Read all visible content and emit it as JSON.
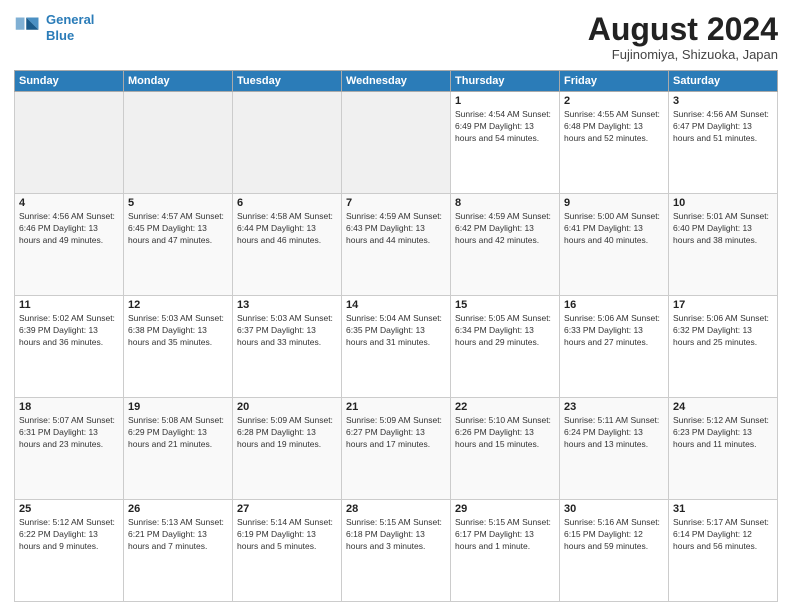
{
  "header": {
    "logo_line1": "General",
    "logo_line2": "Blue",
    "title": "August 2024",
    "subtitle": "Fujinomiya, Shizuoka, Japan"
  },
  "weekdays": [
    "Sunday",
    "Monday",
    "Tuesday",
    "Wednesday",
    "Thursday",
    "Friday",
    "Saturday"
  ],
  "weeks": [
    [
      {
        "day": "",
        "empty": true
      },
      {
        "day": "",
        "empty": true
      },
      {
        "day": "",
        "empty": true
      },
      {
        "day": "",
        "empty": true
      },
      {
        "day": "1",
        "info": "Sunrise: 4:54 AM\nSunset: 6:49 PM\nDaylight: 13 hours\nand 54 minutes."
      },
      {
        "day": "2",
        "info": "Sunrise: 4:55 AM\nSunset: 6:48 PM\nDaylight: 13 hours\nand 52 minutes."
      },
      {
        "day": "3",
        "info": "Sunrise: 4:56 AM\nSunset: 6:47 PM\nDaylight: 13 hours\nand 51 minutes."
      }
    ],
    [
      {
        "day": "4",
        "info": "Sunrise: 4:56 AM\nSunset: 6:46 PM\nDaylight: 13 hours\nand 49 minutes."
      },
      {
        "day": "5",
        "info": "Sunrise: 4:57 AM\nSunset: 6:45 PM\nDaylight: 13 hours\nand 47 minutes."
      },
      {
        "day": "6",
        "info": "Sunrise: 4:58 AM\nSunset: 6:44 PM\nDaylight: 13 hours\nand 46 minutes."
      },
      {
        "day": "7",
        "info": "Sunrise: 4:59 AM\nSunset: 6:43 PM\nDaylight: 13 hours\nand 44 minutes."
      },
      {
        "day": "8",
        "info": "Sunrise: 4:59 AM\nSunset: 6:42 PM\nDaylight: 13 hours\nand 42 minutes."
      },
      {
        "day": "9",
        "info": "Sunrise: 5:00 AM\nSunset: 6:41 PM\nDaylight: 13 hours\nand 40 minutes."
      },
      {
        "day": "10",
        "info": "Sunrise: 5:01 AM\nSunset: 6:40 PM\nDaylight: 13 hours\nand 38 minutes."
      }
    ],
    [
      {
        "day": "11",
        "info": "Sunrise: 5:02 AM\nSunset: 6:39 PM\nDaylight: 13 hours\nand 36 minutes."
      },
      {
        "day": "12",
        "info": "Sunrise: 5:03 AM\nSunset: 6:38 PM\nDaylight: 13 hours\nand 35 minutes."
      },
      {
        "day": "13",
        "info": "Sunrise: 5:03 AM\nSunset: 6:37 PM\nDaylight: 13 hours\nand 33 minutes."
      },
      {
        "day": "14",
        "info": "Sunrise: 5:04 AM\nSunset: 6:35 PM\nDaylight: 13 hours\nand 31 minutes."
      },
      {
        "day": "15",
        "info": "Sunrise: 5:05 AM\nSunset: 6:34 PM\nDaylight: 13 hours\nand 29 minutes."
      },
      {
        "day": "16",
        "info": "Sunrise: 5:06 AM\nSunset: 6:33 PM\nDaylight: 13 hours\nand 27 minutes."
      },
      {
        "day": "17",
        "info": "Sunrise: 5:06 AM\nSunset: 6:32 PM\nDaylight: 13 hours\nand 25 minutes."
      }
    ],
    [
      {
        "day": "18",
        "info": "Sunrise: 5:07 AM\nSunset: 6:31 PM\nDaylight: 13 hours\nand 23 minutes."
      },
      {
        "day": "19",
        "info": "Sunrise: 5:08 AM\nSunset: 6:29 PM\nDaylight: 13 hours\nand 21 minutes."
      },
      {
        "day": "20",
        "info": "Sunrise: 5:09 AM\nSunset: 6:28 PM\nDaylight: 13 hours\nand 19 minutes."
      },
      {
        "day": "21",
        "info": "Sunrise: 5:09 AM\nSunset: 6:27 PM\nDaylight: 13 hours\nand 17 minutes."
      },
      {
        "day": "22",
        "info": "Sunrise: 5:10 AM\nSunset: 6:26 PM\nDaylight: 13 hours\nand 15 minutes."
      },
      {
        "day": "23",
        "info": "Sunrise: 5:11 AM\nSunset: 6:24 PM\nDaylight: 13 hours\nand 13 minutes."
      },
      {
        "day": "24",
        "info": "Sunrise: 5:12 AM\nSunset: 6:23 PM\nDaylight: 13 hours\nand 11 minutes."
      }
    ],
    [
      {
        "day": "25",
        "info": "Sunrise: 5:12 AM\nSunset: 6:22 PM\nDaylight: 13 hours\nand 9 minutes."
      },
      {
        "day": "26",
        "info": "Sunrise: 5:13 AM\nSunset: 6:21 PM\nDaylight: 13 hours\nand 7 minutes."
      },
      {
        "day": "27",
        "info": "Sunrise: 5:14 AM\nSunset: 6:19 PM\nDaylight: 13 hours\nand 5 minutes."
      },
      {
        "day": "28",
        "info": "Sunrise: 5:15 AM\nSunset: 6:18 PM\nDaylight: 13 hours\nand 3 minutes."
      },
      {
        "day": "29",
        "info": "Sunrise: 5:15 AM\nSunset: 6:17 PM\nDaylight: 13 hours\nand 1 minute."
      },
      {
        "day": "30",
        "info": "Sunrise: 5:16 AM\nSunset: 6:15 PM\nDaylight: 12 hours\nand 59 minutes."
      },
      {
        "day": "31",
        "info": "Sunrise: 5:17 AM\nSunset: 6:14 PM\nDaylight: 12 hours\nand 56 minutes."
      }
    ]
  ]
}
